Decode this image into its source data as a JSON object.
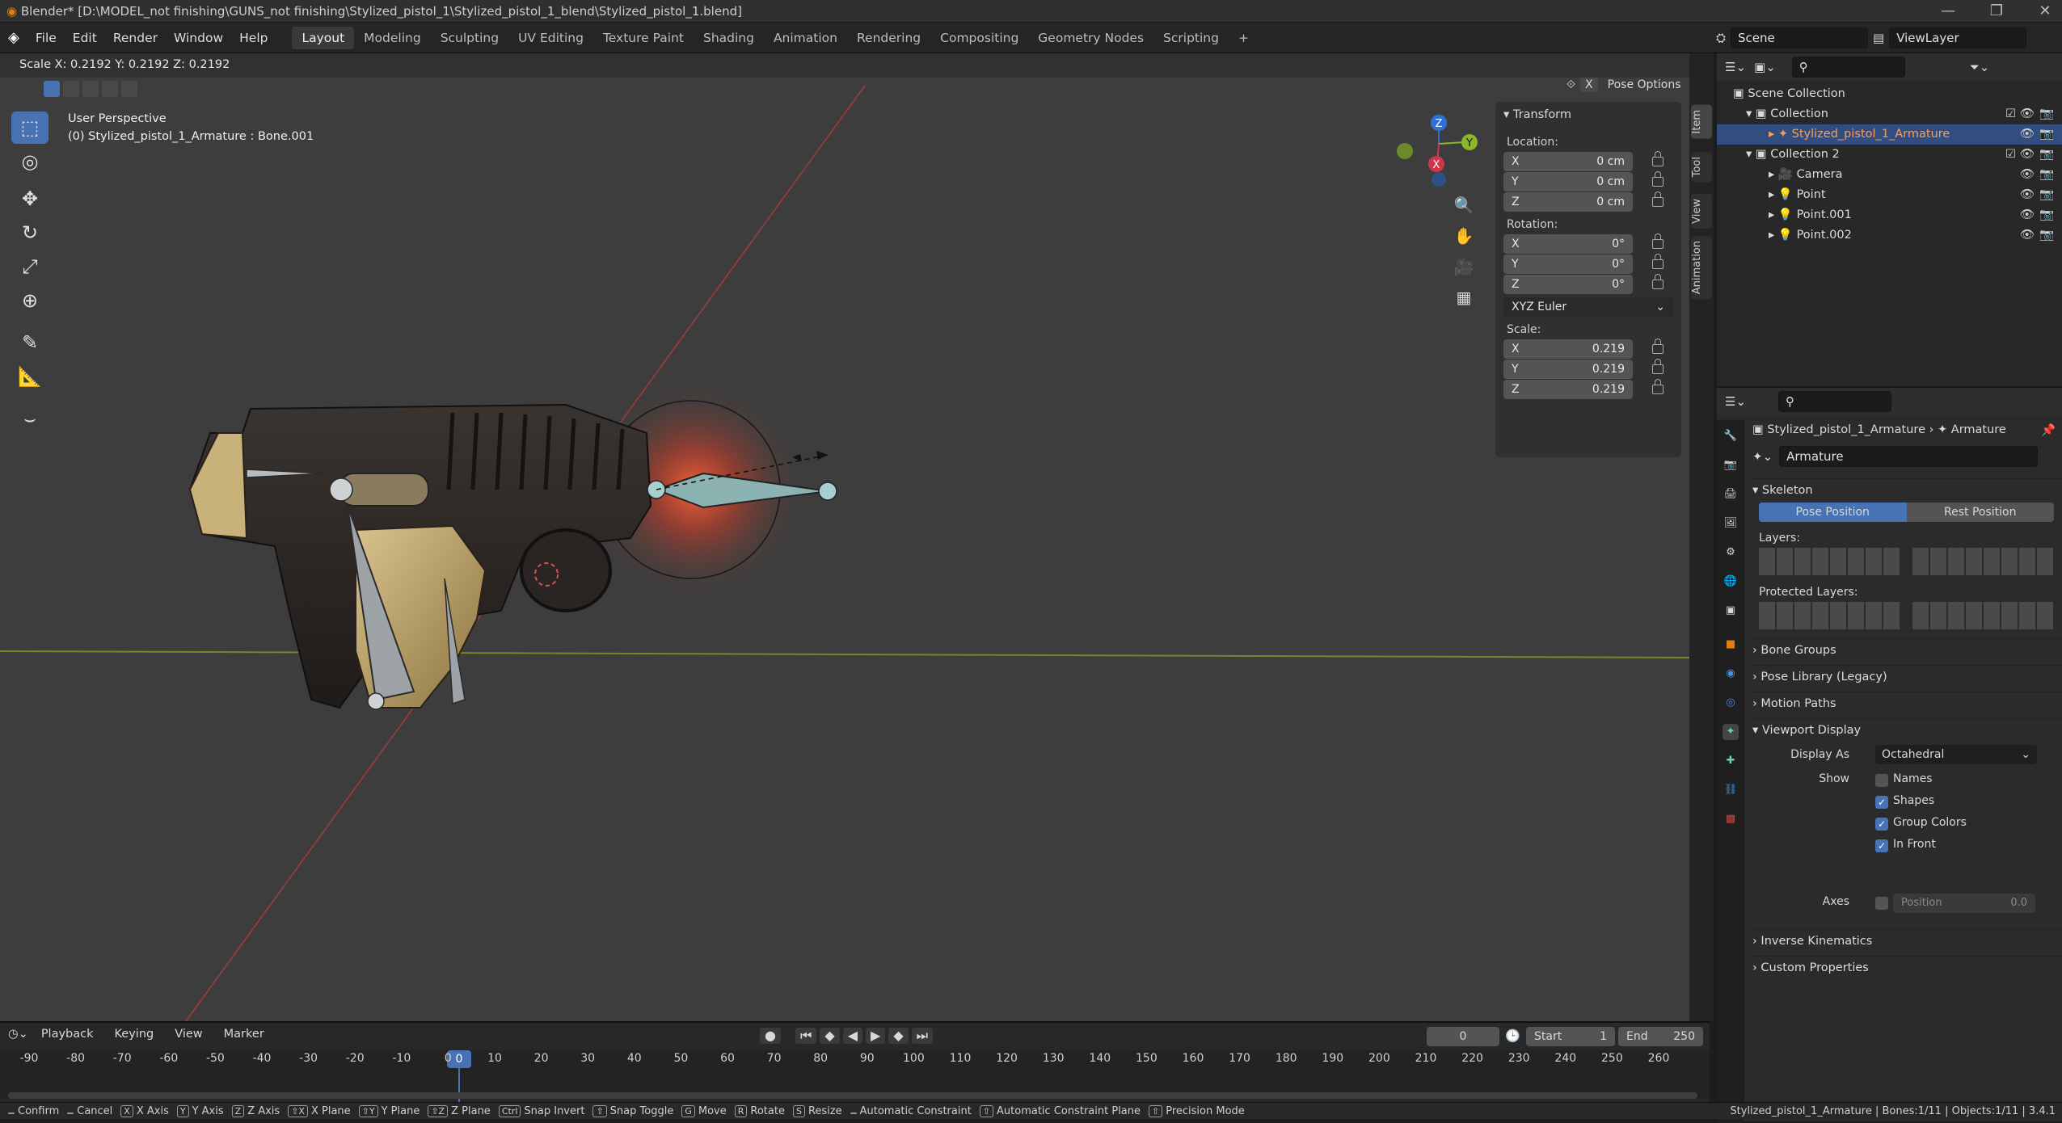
{
  "window": {
    "title": "Blender* [D:\\MODEL_not finishing\\GUNS_not finishing\\Stylized_pistol_1\\Stylized_pistol_1_blend\\Stylized_pistol_1.blend]",
    "minimize": "—",
    "restore": "❐",
    "close": "✕"
  },
  "menu": [
    "File",
    "Edit",
    "Render",
    "Window",
    "Help"
  ],
  "workspaces": [
    "Layout",
    "Modeling",
    "Sculpting",
    "UV Editing",
    "Texture Paint",
    "Shading",
    "Animation",
    "Rendering",
    "Compositing",
    "Geometry Nodes",
    "Scripting"
  ],
  "workspace_add": "+",
  "active_workspace": "Layout",
  "scene": {
    "name": "Scene",
    "viewlayer": "ViewLayer"
  },
  "header_info": "Scale X: 0.2192   Y: 0.2192   Z: 0.2192",
  "viewport": {
    "perspective": "User Perspective",
    "object": "(0) Stylized_pistol_1_Armature : Bone.001",
    "pose_options": "Pose Options",
    "x_btn": "X"
  },
  "gizmo": {
    "x": "X",
    "y": "Y",
    "z": "Z"
  },
  "transform": {
    "title": "Transform",
    "location_label": "Location:",
    "rotation_label": "Rotation:",
    "scale_label": "Scale:",
    "location": [
      {
        "axis": "X",
        "value": "0 cm"
      },
      {
        "axis": "Y",
        "value": "0 cm"
      },
      {
        "axis": "Z",
        "value": "0 cm"
      }
    ],
    "rotation": [
      {
        "axis": "X",
        "value": "0°"
      },
      {
        "axis": "Y",
        "value": "0°"
      },
      {
        "axis": "Z",
        "value": "0°"
      }
    ],
    "rotation_mode": "XYZ Euler",
    "scale": [
      {
        "axis": "X",
        "value": "0.219"
      },
      {
        "axis": "Y",
        "value": "0.219"
      },
      {
        "axis": "Z",
        "value": "0.219"
      }
    ]
  },
  "side_tabs": [
    "Item",
    "Tool",
    "View",
    "Animation"
  ],
  "outliner": {
    "rows": [
      {
        "label": "Scene Collection",
        "indent": 0
      },
      {
        "label": "Collection",
        "indent": 1
      },
      {
        "label": "Stylized_pistol_1_Armature",
        "indent": 2,
        "selected": true
      },
      {
        "label": "Collection 2",
        "indent": 1
      },
      {
        "label": "Camera",
        "indent": 2
      },
      {
        "label": "Point",
        "indent": 2
      },
      {
        "label": "Point.001",
        "indent": 2
      },
      {
        "label": "Point.002",
        "indent": 2
      }
    ]
  },
  "properties": {
    "breadcrumb_object": "Stylized_pistol_1_Armature",
    "breadcrumb_data": "Armature",
    "data_name": "Armature",
    "skeleton": "Skeleton",
    "pose_position": "Pose Position",
    "rest_position": "Rest Position",
    "layers": "Layers:",
    "protected_layers": "Protected Layers:",
    "bone_groups": "Bone Groups",
    "pose_library": "Pose Library (Legacy)",
    "motion_paths": "Motion Paths",
    "viewport_display": "Viewport Display",
    "display_as_label": "Display As",
    "display_as": "Octahedral",
    "show_label": "Show",
    "names": "Names",
    "shapes": "Shapes",
    "group_colors": "Group Colors",
    "in_front": "In Front",
    "axes_label": "Axes",
    "axes_position": "Position",
    "axes_value": "0.0",
    "inverse_kinematics": "Inverse Kinematics",
    "custom_properties": "Custom Properties",
    "checks": {
      "names": false,
      "shapes": true,
      "group_colors": true,
      "in_front": true,
      "axes": false
    }
  },
  "timeline": {
    "menu": [
      "Playback",
      "Keying",
      "View",
      "Marker"
    ],
    "current_frame": "0",
    "start_label": "Start",
    "start": "1",
    "end_label": "End",
    "end": "250",
    "ticks": [
      "-90",
      "-80",
      "-70",
      "-60",
      "-50",
      "-40",
      "-30",
      "-20",
      "-10",
      "0",
      "10",
      "20",
      "30",
      "40",
      "50",
      "60",
      "70",
      "80",
      "90",
      "100",
      "110",
      "120",
      "130",
      "140",
      "150",
      "160",
      "170",
      "180",
      "190",
      "200",
      "210",
      "220",
      "230",
      "240",
      "250",
      "260"
    ]
  },
  "status": {
    "items": [
      "Confirm",
      "Cancel",
      "X Axis",
      "Y Axis",
      "Z Axis",
      "X Plane",
      "Y Plane",
      "Z Plane",
      "Snap Invert",
      "Snap Toggle",
      "Move",
      "Rotate",
      "Resize",
      "Automatic Constraint",
      "Automatic Constraint Plane",
      "Precision Mode"
    ],
    "keys": [
      "",
      "",
      "X",
      "Y",
      "Z",
      "⇧X",
      "⇧Y",
      "⇧Z",
      "Ctrl",
      "⇧",
      "G",
      "R",
      "S",
      "",
      "⇧",
      "⇧"
    ],
    "right": "Stylized_pistol_1_Armature | Bones:1/11 | Objects:1/11 | 3.4.1"
  },
  "colors": {
    "accent": "#4772b3",
    "selected_row": "#334d80",
    "viewport_bg": "#3d3d3d",
    "x_axis": "#d0364b",
    "y_axis": "#8bb72a",
    "z_axis": "#2f6fd8"
  }
}
